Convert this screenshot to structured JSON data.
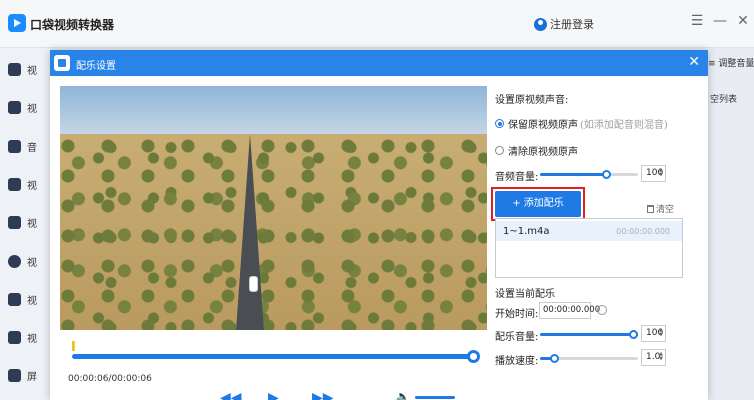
{
  "app": {
    "title": "口袋视频转换器",
    "login_label": "注册登录",
    "menu_glyph": "☰",
    "minimize_glyph": "—",
    "close_glyph": "✕"
  },
  "sidebar": {
    "items": [
      {
        "label": "视"
      },
      {
        "label": "视"
      },
      {
        "label": "音"
      },
      {
        "label": "视"
      },
      {
        "label": "视"
      },
      {
        "label": "视"
      },
      {
        "label": "视"
      },
      {
        "label": "视"
      },
      {
        "label": "屏"
      }
    ]
  },
  "right_fragments": {
    "adjust": "调整音量",
    "clear_list": "空列表",
    "adjust_prefix": "≡"
  },
  "dialog": {
    "title": "配乐设置",
    "close_glyph": "✕",
    "timecode": "00:00:06/00:00:06",
    "marker_glyph": "I",
    "controls": {
      "prev": "◀◀",
      "play": "▶",
      "next": "▶▶",
      "volume": "🔈"
    },
    "original_audio": {
      "title": "设置原视频声音:",
      "keep_label": "保留原视频原声",
      "keep_hint": "(如添加配音则混音)",
      "remove_label": "清除原视频原声",
      "volume_label": "音频音量:",
      "volume_value": "100",
      "volume_percent": 67
    },
    "add_music_label": "+ 添加配乐",
    "clear_label": "清空",
    "music_list": [
      {
        "name": "1~1.m4a",
        "duration": "00:00:00.000"
      }
    ],
    "current_music": {
      "title": "设置当前配乐",
      "start_label": "开始时间:",
      "start_value": "00:00:00.000",
      "volume_label": "配乐音量:",
      "volume_value": "100",
      "volume_percent": 100,
      "speed_label": "播放速度:",
      "speed_value": "1.0",
      "speed_percent": 14
    }
  },
  "colors": {
    "accent": "#1f7ae6",
    "highlight": "#e02020",
    "titlebar": "#2a84e8"
  }
}
